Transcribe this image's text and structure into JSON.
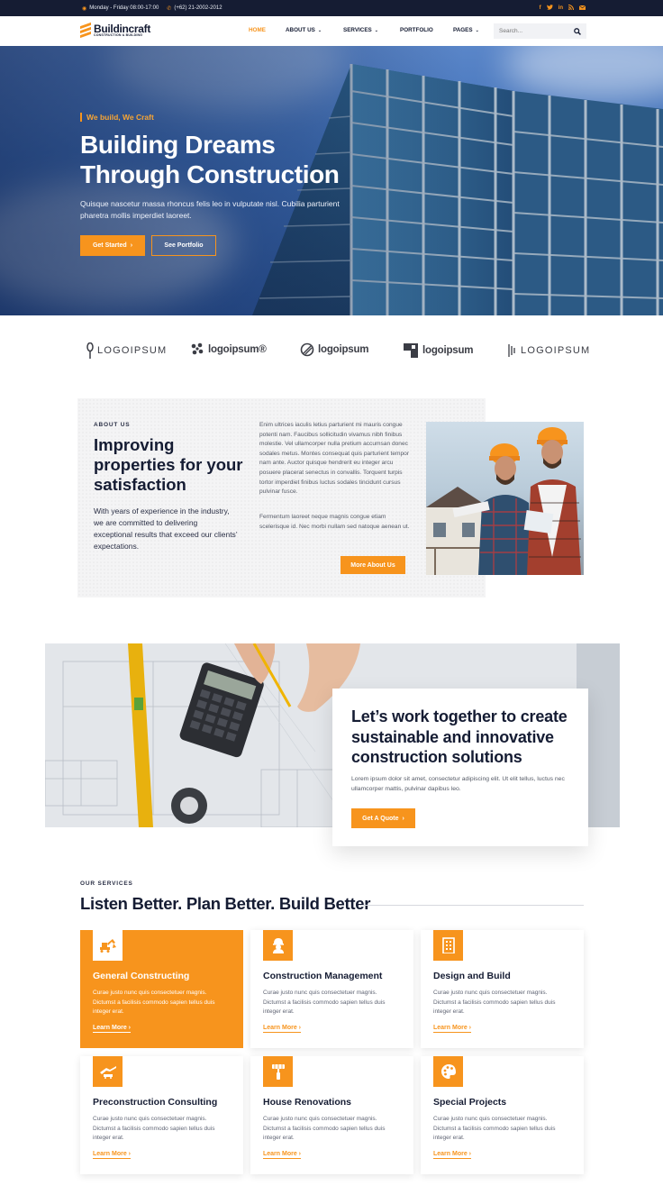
{
  "topbar": {
    "hours": "Monday - Friday 08:00-17:00",
    "phone": "(+62) 21-2002-2012",
    "social": [
      "facebook-icon",
      "twitter-icon",
      "linkedin-icon",
      "rss-icon",
      "mail-icon"
    ]
  },
  "brand": {
    "name": "Buildincraft",
    "tagline": "CONSTRUCTION & BUILDING",
    "accent": "#f7941d",
    "dark": "#151c33"
  },
  "nav": {
    "items": [
      {
        "label": "Home",
        "active": true
      },
      {
        "label": "About Us",
        "dropdown": true
      },
      {
        "label": "Services",
        "dropdown": true
      },
      {
        "label": "Portfolio"
      },
      {
        "label": "Pages",
        "dropdown": true
      }
    ],
    "search_placeholder": "Search..."
  },
  "hero": {
    "tag": "We build, We Craft",
    "title_line1": "Building Dreams",
    "title_line2": "Through Construction",
    "subtitle": "Quisque nascetur massa rhoncus felis leo in vulputate nisl. Cubilia parturient pharetra mollis imperdiet laoreet.",
    "primary_button": "Get Started",
    "secondary_button": "See Portfolio"
  },
  "logos": [
    "LOGOIPSUM",
    "logoipsum®",
    "logoipsum",
    "logoipsum",
    "LOGOIPSUM"
  ],
  "about": {
    "label": "ABOUT US",
    "title": "Improving properties for your satisfaction",
    "lead": "With years of experience in the industry, we are committed to delivering exceptional results that exceed our clients’ expectations.",
    "body1": "Enim ultrices iaculis letius parturient mi mauris congue potenti nam. Faucibus sollicitudin vivamus nibh finibus molestie. Vel ullamcorper nulla pretium accumsan donec sodales metus. Montes consequat quis parturient tempor nam ante. Auctor quisque hendrerit eu integer arcu posuere placerat senectus in convallis. Torquent turpis tortor imperdiet finibus luctus sodales tincidunt cursus pulvinar fusce.",
    "body2": "Fermentum laoreet neque magnis congue etiam scelerisque id. Nec morbi nullam sed natoque aenean ut.",
    "button": "More About Us"
  },
  "cta": {
    "title": "Let’s work together to create sustainable and innovative construction solutions",
    "text": "Lorem ipsum dolor sit amet, consectetur adipiscing elit. Ut elit tellus, luctus nec ullamcorper mattis, pulvinar dapibus leo.",
    "button": "Get A Quote"
  },
  "services": {
    "label": "OUR SERVICES",
    "title": "Listen Better. Plan Better. Build Better",
    "cards": [
      {
        "title": "General Constructing",
        "desc": "Curae justo nunc quis consectetuer magnis. Dictumst a facilisis commodo sapien tellus duis integer erat.",
        "link": "Learn More",
        "icon": "excavator-icon",
        "featured": true
      },
      {
        "title": "Construction Management",
        "desc": "Curae justo nunc quis consectetuer magnis. Dictumst a facilisis commodo sapien tellus duis integer erat.",
        "link": "Learn More",
        "icon": "worker-icon"
      },
      {
        "title": "Design and Build",
        "desc": "Curae justo nunc quis consectetuer magnis. Dictumst a facilisis commodo sapien tellus duis integer erat.",
        "link": "Learn More",
        "icon": "building-icon"
      },
      {
        "title": "Preconstruction Consulting",
        "desc": "Curae justo nunc quis consectetuer magnis. Dictumst a facilisis commodo sapien tellus duis integer erat.",
        "link": "Learn More",
        "icon": "crane-icon"
      },
      {
        "title": "House Renovations",
        "desc": "Curae justo nunc quis consectetuer magnis. Dictumst a facilisis commodo sapien tellus duis integer erat.",
        "link": "Learn More",
        "icon": "paint-roller-icon"
      },
      {
        "title": "Special Projects",
        "desc": "Curae justo nunc quis consectetuer magnis. Dictumst a facilisis commodo sapien tellus duis integer erat.",
        "link": "Learn More",
        "icon": "palette-icon"
      }
    ]
  }
}
